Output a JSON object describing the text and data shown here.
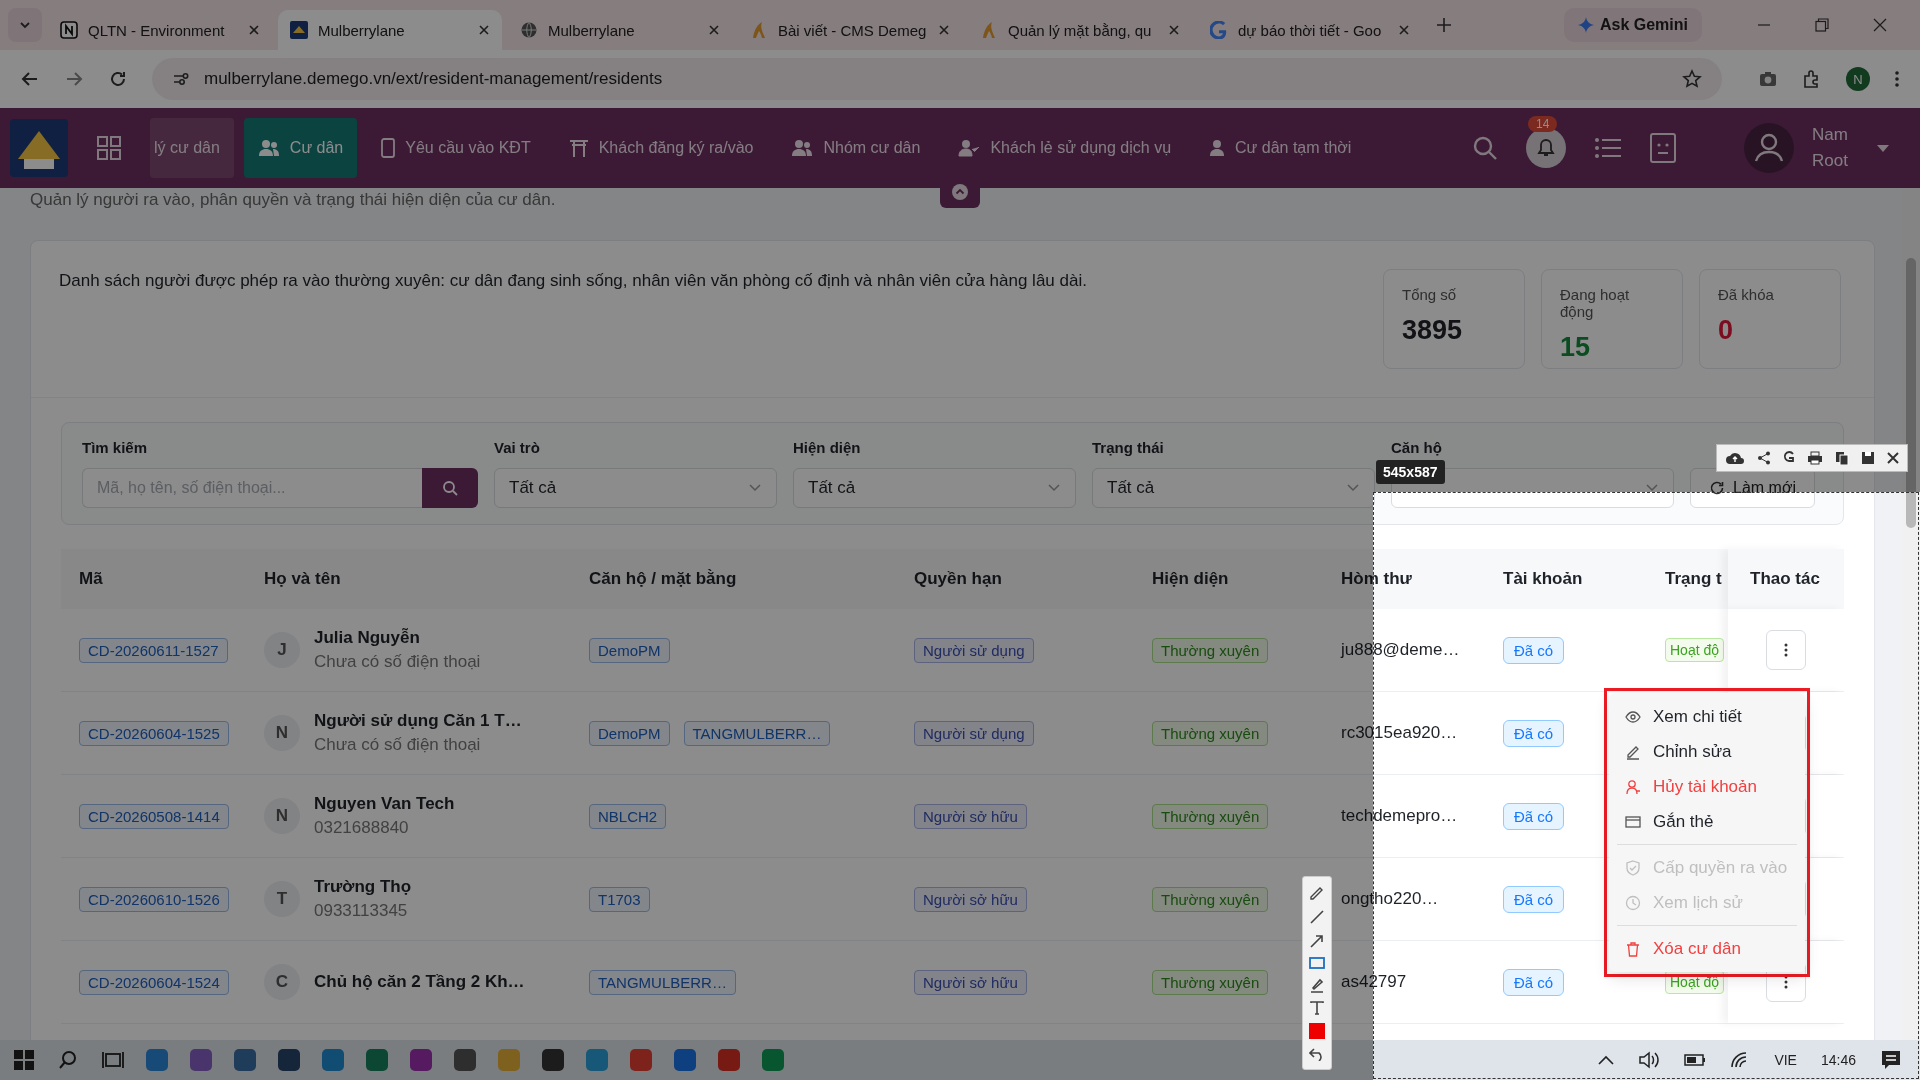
{
  "browser": {
    "tabs": [
      {
        "title": "QLTN - Environment",
        "kind": "notion",
        "selected": false
      },
      {
        "title": "Mulberrylane",
        "kind": "site",
        "selected": true
      },
      {
        "title": "Mulberrylane",
        "kind": "globe",
        "selected": false
      },
      {
        "title": "Bài viết - CMS Demeg",
        "kind": "cms",
        "selected": false
      },
      {
        "title": "Quản lý mặt bằng, qu",
        "kind": "cms",
        "selected": false
      },
      {
        "title": "dự báo thời tiết - Goo",
        "kind": "google",
        "selected": false
      }
    ],
    "gemini": "Ask Gemini",
    "url": "mulberrylane.demego.vn/ext/resident-management/residents",
    "profile": "N"
  },
  "app": {
    "nav": [
      {
        "label": "lý cư dân",
        "kind": "none",
        "selected": false
      },
      {
        "label": "Cư dân",
        "kind": "group",
        "selected": true
      },
      {
        "label": "Yêu cầu vào KĐT",
        "kind": "phone",
        "selected": false
      },
      {
        "label": "Khách đăng ký ra/vào",
        "kind": "gate",
        "selected": false
      },
      {
        "label": "Nhóm cư dân",
        "kind": "group",
        "selected": false
      },
      {
        "label": "Khách lẻ sử dụng dịch vụ",
        "kind": "usercheck",
        "selected": false
      },
      {
        "label": "Cư dân tạm thời",
        "kind": "user",
        "selected": false
      }
    ],
    "notifications": "14",
    "user": {
      "name": "Nam",
      "role": "Root"
    }
  },
  "page": {
    "subtitle": "Quản lý người ra vào, phân quyền và trạng thái hiện diện của cư dân.",
    "description": "Danh sách người được phép ra vào thường xuyên: cư dân đang sinh sống, nhân viên văn phòng cố định và nhân viên cửa hàng lâu dài.",
    "stats": [
      {
        "label": "Tổng số",
        "value": "3895",
        "kind": "total"
      },
      {
        "label": "Đang hoạt động",
        "value": "15",
        "kind": "active"
      },
      {
        "label": "Đã khóa",
        "value": "0",
        "kind": "locked"
      }
    ]
  },
  "filters": [
    {
      "label": "Tìm kiếm",
      "kind": "search",
      "placeholder": "Mã, họ tên, số điện thoại..."
    },
    {
      "label": "Vai trò",
      "kind": "select",
      "value": "Tất cả"
    },
    {
      "label": "Hiện diện",
      "kind": "select",
      "value": "Tất cả"
    },
    {
      "label": "Trạng thái",
      "kind": "select",
      "value": "Tất cả"
    },
    {
      "label": "Căn hộ",
      "kind": "select"
    }
  ],
  "refresh": "Làm mới",
  "table": {
    "columns": [
      "Mã",
      "Họ và tên",
      "Căn hộ / mặt bằng",
      "Quyền hạn",
      "Hiện diện",
      "Hòm thư",
      "Tài khoản",
      "Trạng t",
      "Thao tác"
    ],
    "rows": [
      {
        "code": "CD-20260611-1527",
        "initial": "J",
        "name": "Julia Nguyễn",
        "phone": "Chưa có số điện thoại",
        "units": [
          "DemoPM"
        ],
        "role": "Người sử dụng",
        "presence": "Thường xuyên",
        "email": "ju888@deme…",
        "account": "Đã có",
        "status": "Hoạt độ"
      },
      {
        "code": "CD-20260604-1525",
        "initial": "N",
        "name": "Người sử dụng Căn 1 T…",
        "phone": "Chưa có số điện thoại",
        "units": [
          "DemoPM",
          "TANGMULBERR…"
        ],
        "role": "Người sử dụng",
        "presence": "Thường xuyên",
        "email": "rc3015ea920…",
        "account": "Đã có"
      },
      {
        "code": "CD-20260508-1414",
        "initial": "N",
        "name": "Nguyen Van Tech",
        "phone": "0321688840",
        "units": [
          "NBLCH2"
        ],
        "role": "Người sở hữu",
        "presence": "Thường xuyên",
        "email": "techdemepro…",
        "account": "Đã có"
      },
      {
        "code": "CD-20260610-1526",
        "initial": "T",
        "name": "Trường Thọ",
        "phone": "0933113345",
        "units": [
          "T1703"
        ],
        "role": "Người sở hữu",
        "presence": "Thường xuyên",
        "email": "ongtho220…",
        "account": "Đã có"
      },
      {
        "code": "CD-20260604-1524",
        "initial": "C",
        "name": "Chủ hộ căn 2 Tầng 2 Kh…",
        "units": [
          "TANGMULBERR…"
        ],
        "role": "Người sở hữu",
        "presence": "Thường xuyên",
        "email": "as42797",
        "account": "Đã có",
        "status": "Hoạt độ"
      }
    ]
  },
  "menu": {
    "groups": [
      [
        {
          "label": "Xem chi tiết",
          "kind": "eye",
          "danger": false,
          "disabled": false
        },
        {
          "label": "Chỉnh sửa",
          "kind": "pencil",
          "danger": false,
          "disabled": false
        },
        {
          "label": "Hủy tài khoản",
          "kind": "user",
          "danger": true,
          "disabled": false
        },
        {
          "label": "Gắn thẻ",
          "kind": "card",
          "danger": false,
          "disabled": false
        }
      ],
      [
        {
          "label": "Cấp quyền ra vào",
          "kind": "shield",
          "danger": false,
          "disabled": true
        },
        {
          "label": "Xem lịch sử",
          "kind": "clock",
          "danger": false,
          "disabled": true
        }
      ],
      [
        {
          "label": "Xóa cư dân",
          "kind": "trash",
          "danger": true,
          "disabled": false
        }
      ]
    ]
  },
  "capture": {
    "size": "545x587"
  },
  "taskbar": {
    "language": "VIE",
    "time": "14:46"
  }
}
